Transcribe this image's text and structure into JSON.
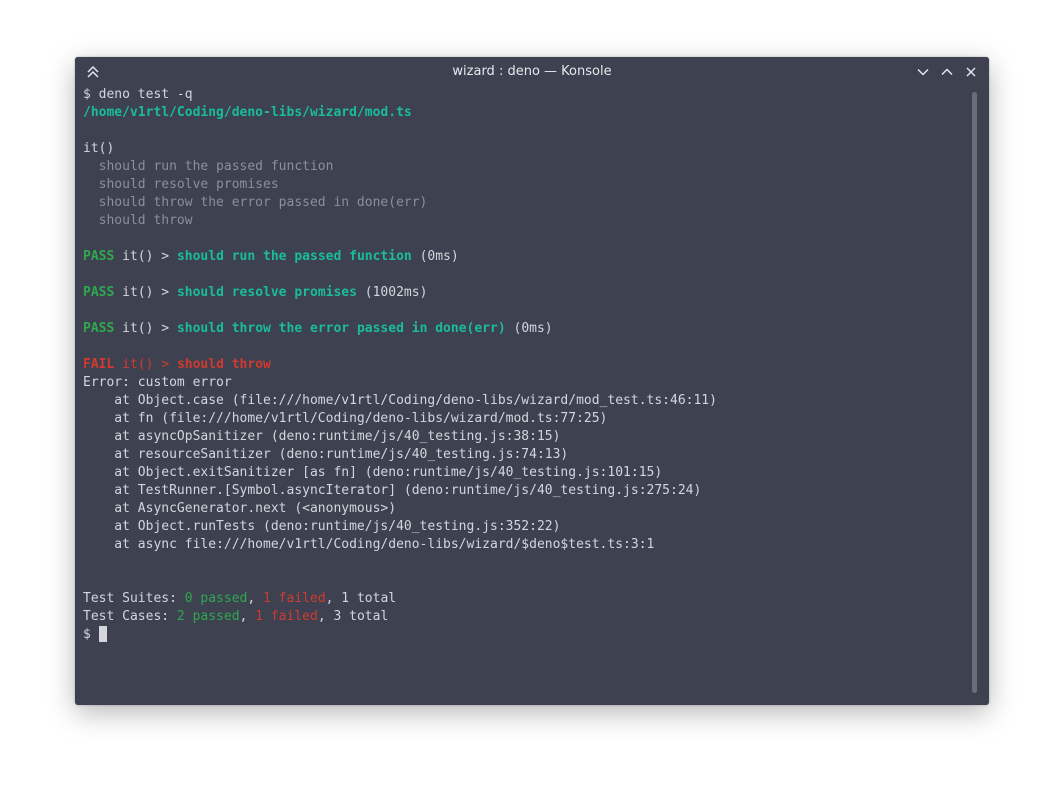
{
  "window": {
    "title": "wizard : deno — Konsole",
    "buttons": [
      "minimize",
      "maximize",
      "close"
    ]
  },
  "terminal": {
    "prompt_cmd": "$ deno test -q",
    "test_file": "/home/v1rtl/Coding/deno-libs/wizard/mod.ts",
    "suite_name": "it()",
    "test_list": [
      "  should run the passed function",
      "  should resolve promises",
      "  should throw the error passed in done(err)",
      "  should throw"
    ],
    "results": [
      {
        "status": "PASS",
        "prefix": " it() > ",
        "name": "should run the passed function",
        "time": " (0ms)"
      },
      {
        "status": "PASS",
        "prefix": " it() > ",
        "name": "should resolve promises",
        "time": " (1002ms)"
      },
      {
        "status": "PASS",
        "prefix": " it() > ",
        "name": "should throw the error passed in done(err)",
        "time": " (0ms)"
      }
    ],
    "fail": {
      "status": "FAIL",
      "prefix": " it() > ",
      "name": "should throw"
    },
    "error_message": "Error: custom error",
    "stack": [
      "    at Object.case (file:///home/v1rtl/Coding/deno-libs/wizard/mod_test.ts:46:11)",
      "    at fn (file:///home/v1rtl/Coding/deno-libs/wizard/mod.ts:77:25)",
      "    at asyncOpSanitizer (deno:runtime/js/40_testing.js:38:15)",
      "    at resourceSanitizer (deno:runtime/js/40_testing.js:74:13)",
      "    at Object.exitSanitizer [as fn] (deno:runtime/js/40_testing.js:101:15)",
      "    at TestRunner.[Symbol.asyncIterator] (deno:runtime/js/40_testing.js:275:24)",
      "    at AsyncGenerator.next (<anonymous>)",
      "    at Object.runTests (deno:runtime/js/40_testing.js:352:22)",
      "    at async file:///home/v1rtl/Coding/deno-libs/wizard/$deno$test.ts:3:1"
    ],
    "summary": {
      "suites_label": "Test Suites: ",
      "suites_passed": "0 passed",
      "suites_failed": "1 failed",
      "suites_total": ", 1 total",
      "cases_label": "Test Cases: ",
      "cases_passed": "2 passed",
      "cases_failed": "1 failed",
      "cases_total": ", 3 total",
      "sep": ", "
    },
    "final_prompt": "$ "
  },
  "colors": {
    "background": "#3d4150",
    "teal": "#1abc9c",
    "pass_green": "#2fa84f",
    "fail_red": "#d03a2f",
    "dim": "#8b8f99",
    "text": "#d4d6dc"
  },
  "icons": {
    "app_menu": "double-chevron-up-icon",
    "minimize": "chevron-down-icon",
    "maximize": "chevron-up-icon",
    "close": "close-icon"
  }
}
